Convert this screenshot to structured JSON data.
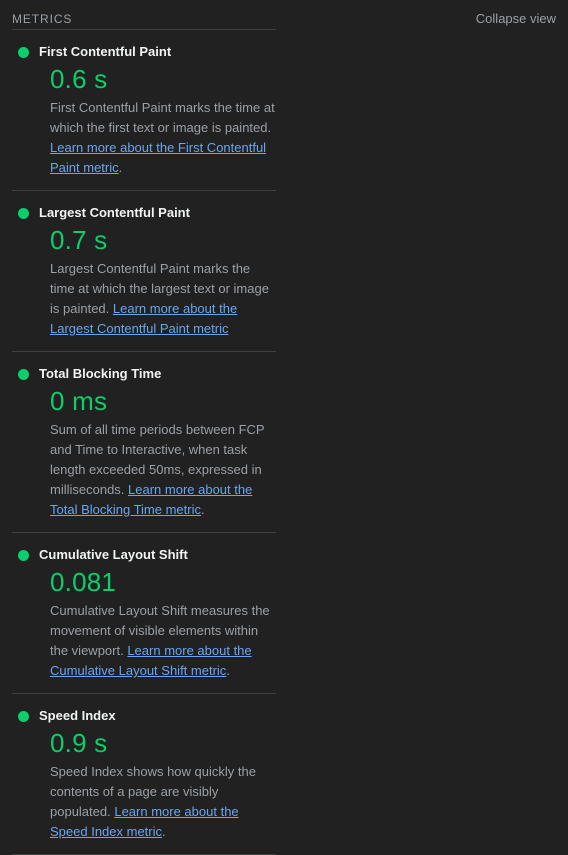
{
  "header": {
    "title": "METRICS",
    "collapse_label": "Collapse view"
  },
  "colors": {
    "background": "#212121",
    "pass_green": "#0cce6b",
    "link_blue": "#6ba5f0",
    "muted_text": "#9aa0a6",
    "divider": "#3c4043",
    "title_text": "#f1f3f4"
  },
  "metrics": [
    {
      "id": "first-contentful-paint",
      "status_icon": "pass-circle-icon",
      "title": "First Contentful Paint",
      "value": "0.6 s",
      "description_lead": "First Contentful Paint marks the time at which the first text or image is painted. ",
      "link_text": "Learn more about the First Contentful Paint metric",
      "description_tail": "."
    },
    {
      "id": "largest-contentful-paint",
      "status_icon": "pass-circle-icon",
      "title": "Largest Contentful Paint",
      "value": "0.7 s",
      "description_lead": "Largest Contentful Paint marks the time at which the largest text or image is painted. ",
      "link_text": "Learn more about the Largest Contentful Paint metric",
      "description_tail": ""
    },
    {
      "id": "total-blocking-time",
      "status_icon": "pass-circle-icon",
      "title": "Total Blocking Time",
      "value": "0 ms",
      "description_lead": "Sum of all time periods between FCP and Time to Interactive, when task length exceeded 50ms, expressed in milliseconds. ",
      "link_text": "Learn more about the Total Blocking Time metric",
      "description_tail": "."
    },
    {
      "id": "cumulative-layout-shift",
      "status_icon": "pass-circle-icon",
      "title": "Cumulative Layout Shift",
      "value": "0.081",
      "description_lead": "Cumulative Layout Shift measures the movement of visible elements within the viewport. ",
      "link_text": "Learn more about the Cumulative Layout Shift metric",
      "description_tail": "."
    },
    {
      "id": "speed-index",
      "status_icon": "pass-circle-icon",
      "title": "Speed Index",
      "value": "0.9 s",
      "description_lead": "Speed Index shows how quickly the contents of a page are visibly populated. ",
      "link_text": "Learn more about the Speed Index metric",
      "description_tail": "."
    }
  ]
}
